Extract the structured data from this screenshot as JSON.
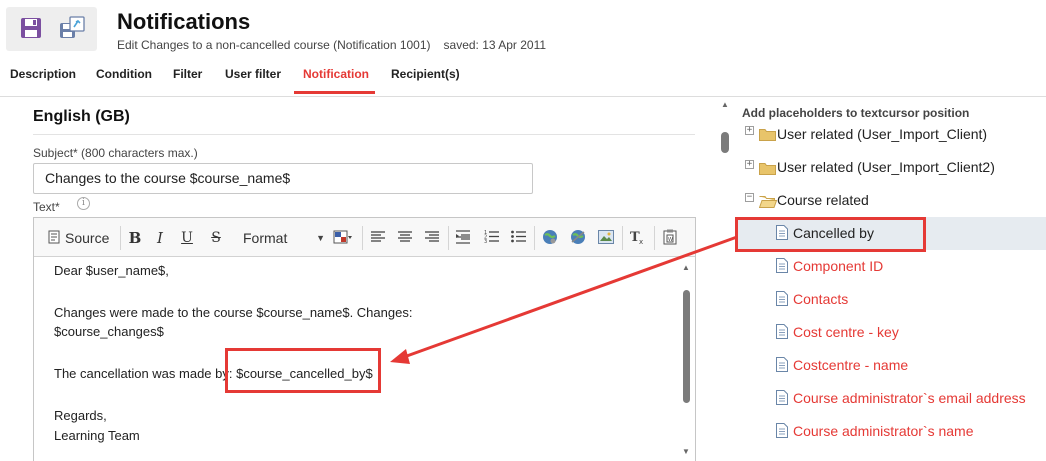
{
  "header": {
    "title": "Notifications",
    "subtitle": "Edit Changes to a non-cancelled course (Notification 1001)",
    "saved": "saved: 13 Apr 2011"
  },
  "tabs": [
    {
      "label": "Description",
      "active": false
    },
    {
      "label": "Condition",
      "active": false
    },
    {
      "label": "Filter",
      "active": false
    },
    {
      "label": "User filter",
      "active": false
    },
    {
      "label": "Notification",
      "active": true
    },
    {
      "label": "Recipient(s)",
      "active": false
    }
  ],
  "editor_section": {
    "language": "English (GB)",
    "subject_label": "Subject* (800 characters max.)",
    "subject_value": "Changes to the course $course_name$",
    "text_label": "Text*",
    "toolbar": {
      "source": "Source",
      "bold": "B",
      "italic": "I",
      "underline": "U",
      "strike": "S",
      "format": "Format"
    },
    "body_lines": [
      "Dear $user_name$,",
      "Changes were made to the course $course_name$. Changes:",
      "$course_changes$",
      "The cancellation was made by: $course_cancelled_by$",
      "Regards,",
      "Learning Team"
    ]
  },
  "placeholders_panel": {
    "title": "Add placeholders to textcursor position",
    "groups": [
      {
        "label": "User related (User_Import_Client)",
        "expanded": false
      },
      {
        "label": "User related (User_Import_Client2)",
        "expanded": false
      },
      {
        "label": "Course related",
        "expanded": true
      }
    ],
    "items": [
      {
        "label": "Cancelled by",
        "selected": true
      },
      {
        "label": "Component ID",
        "selected": false
      },
      {
        "label": "Contacts",
        "selected": false
      },
      {
        "label": "Cost centre - key",
        "selected": false
      },
      {
        "label": "Costcentre - name",
        "selected": false
      },
      {
        "label": "Course administrator`s email address",
        "selected": false
      },
      {
        "label": "Course administrator`s name",
        "selected": false
      }
    ]
  },
  "colors": {
    "accent": "#e53935",
    "selected_row": "#e6ebf0",
    "folder": "#e8c46a"
  }
}
